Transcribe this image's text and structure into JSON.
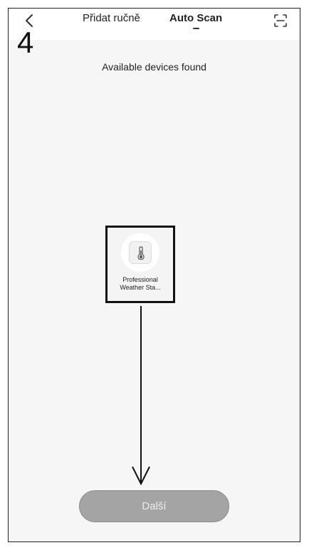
{
  "header": {
    "tabs": [
      {
        "label": "Přidat ručně",
        "active": false
      },
      {
        "label": "Auto Scan",
        "active": true
      }
    ]
  },
  "step_label": "4",
  "scan": {
    "subtitle": "Available devices found"
  },
  "devices": [
    {
      "name_line1": "Professional",
      "name_line2": "Weather Sta...",
      "icon": "thermometer-icon",
      "highlighted": true
    }
  ],
  "footer": {
    "next_label": "Další"
  },
  "colors": {
    "background": "#f6f6f6",
    "button": "#a4a4a4",
    "button_text": "#ececec",
    "highlight_border": "#111111"
  }
}
